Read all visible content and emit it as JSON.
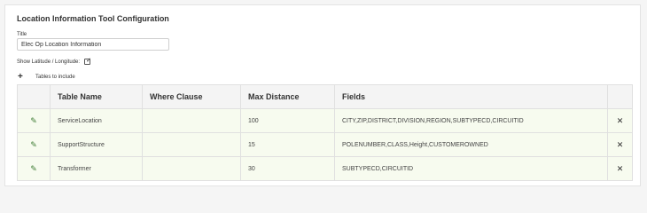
{
  "panel": {
    "title": "Location Information Tool Configuration"
  },
  "title_field": {
    "label": "Title",
    "value": "Elec Op Location Information"
  },
  "latlong": {
    "label": "Show Latitude / Longitude:",
    "checked": true
  },
  "tables_section": {
    "add_label": "Tables to include"
  },
  "icons": {
    "add": "plus-icon",
    "edit": "pencil-icon",
    "delete": "close-icon"
  },
  "colors": {
    "row_background": "#f7fbef",
    "edit_icon": "#3e7c34"
  },
  "table": {
    "columns": [
      "",
      "Table Name",
      "Where Clause",
      "Max Distance",
      "Fields",
      ""
    ],
    "rows": [
      {
        "table_name": "ServiceLocation",
        "where_clause": "",
        "max_distance": "100",
        "fields": "CITY,ZIP,DISTRICT,DIVISION,REGION,SUBTYPECD,CIRCUITID"
      },
      {
        "table_name": "SupportStructure",
        "where_clause": "",
        "max_distance": "15",
        "fields": "POLENUMBER,CLASS,Height,CUSTOMEROWNED"
      },
      {
        "table_name": "Transformer",
        "where_clause": "",
        "max_distance": "30",
        "fields": "SUBTYPECD,CIRCUITID"
      }
    ]
  }
}
